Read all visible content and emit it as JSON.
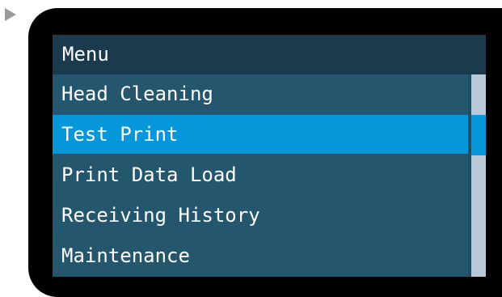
{
  "menu": {
    "title": "Menu",
    "items": [
      {
        "label": "Head Cleaning",
        "selected": false
      },
      {
        "label": "Test Print",
        "selected": true
      },
      {
        "label": "Print Data Load",
        "selected": false
      },
      {
        "label": "Receiving History",
        "selected": false
      },
      {
        "label": "Maintenance",
        "selected": false
      }
    ]
  },
  "scrollbar": {
    "visible_fraction": 0.2,
    "position_fraction": 0.2
  },
  "colors": {
    "screen_background": "#24566e",
    "title_background": "#1c3a4e",
    "selection": "#0696da",
    "bezel": "#000000",
    "text": "#ffffff"
  },
  "icons": {
    "pointer": "triangle-right-icon"
  }
}
